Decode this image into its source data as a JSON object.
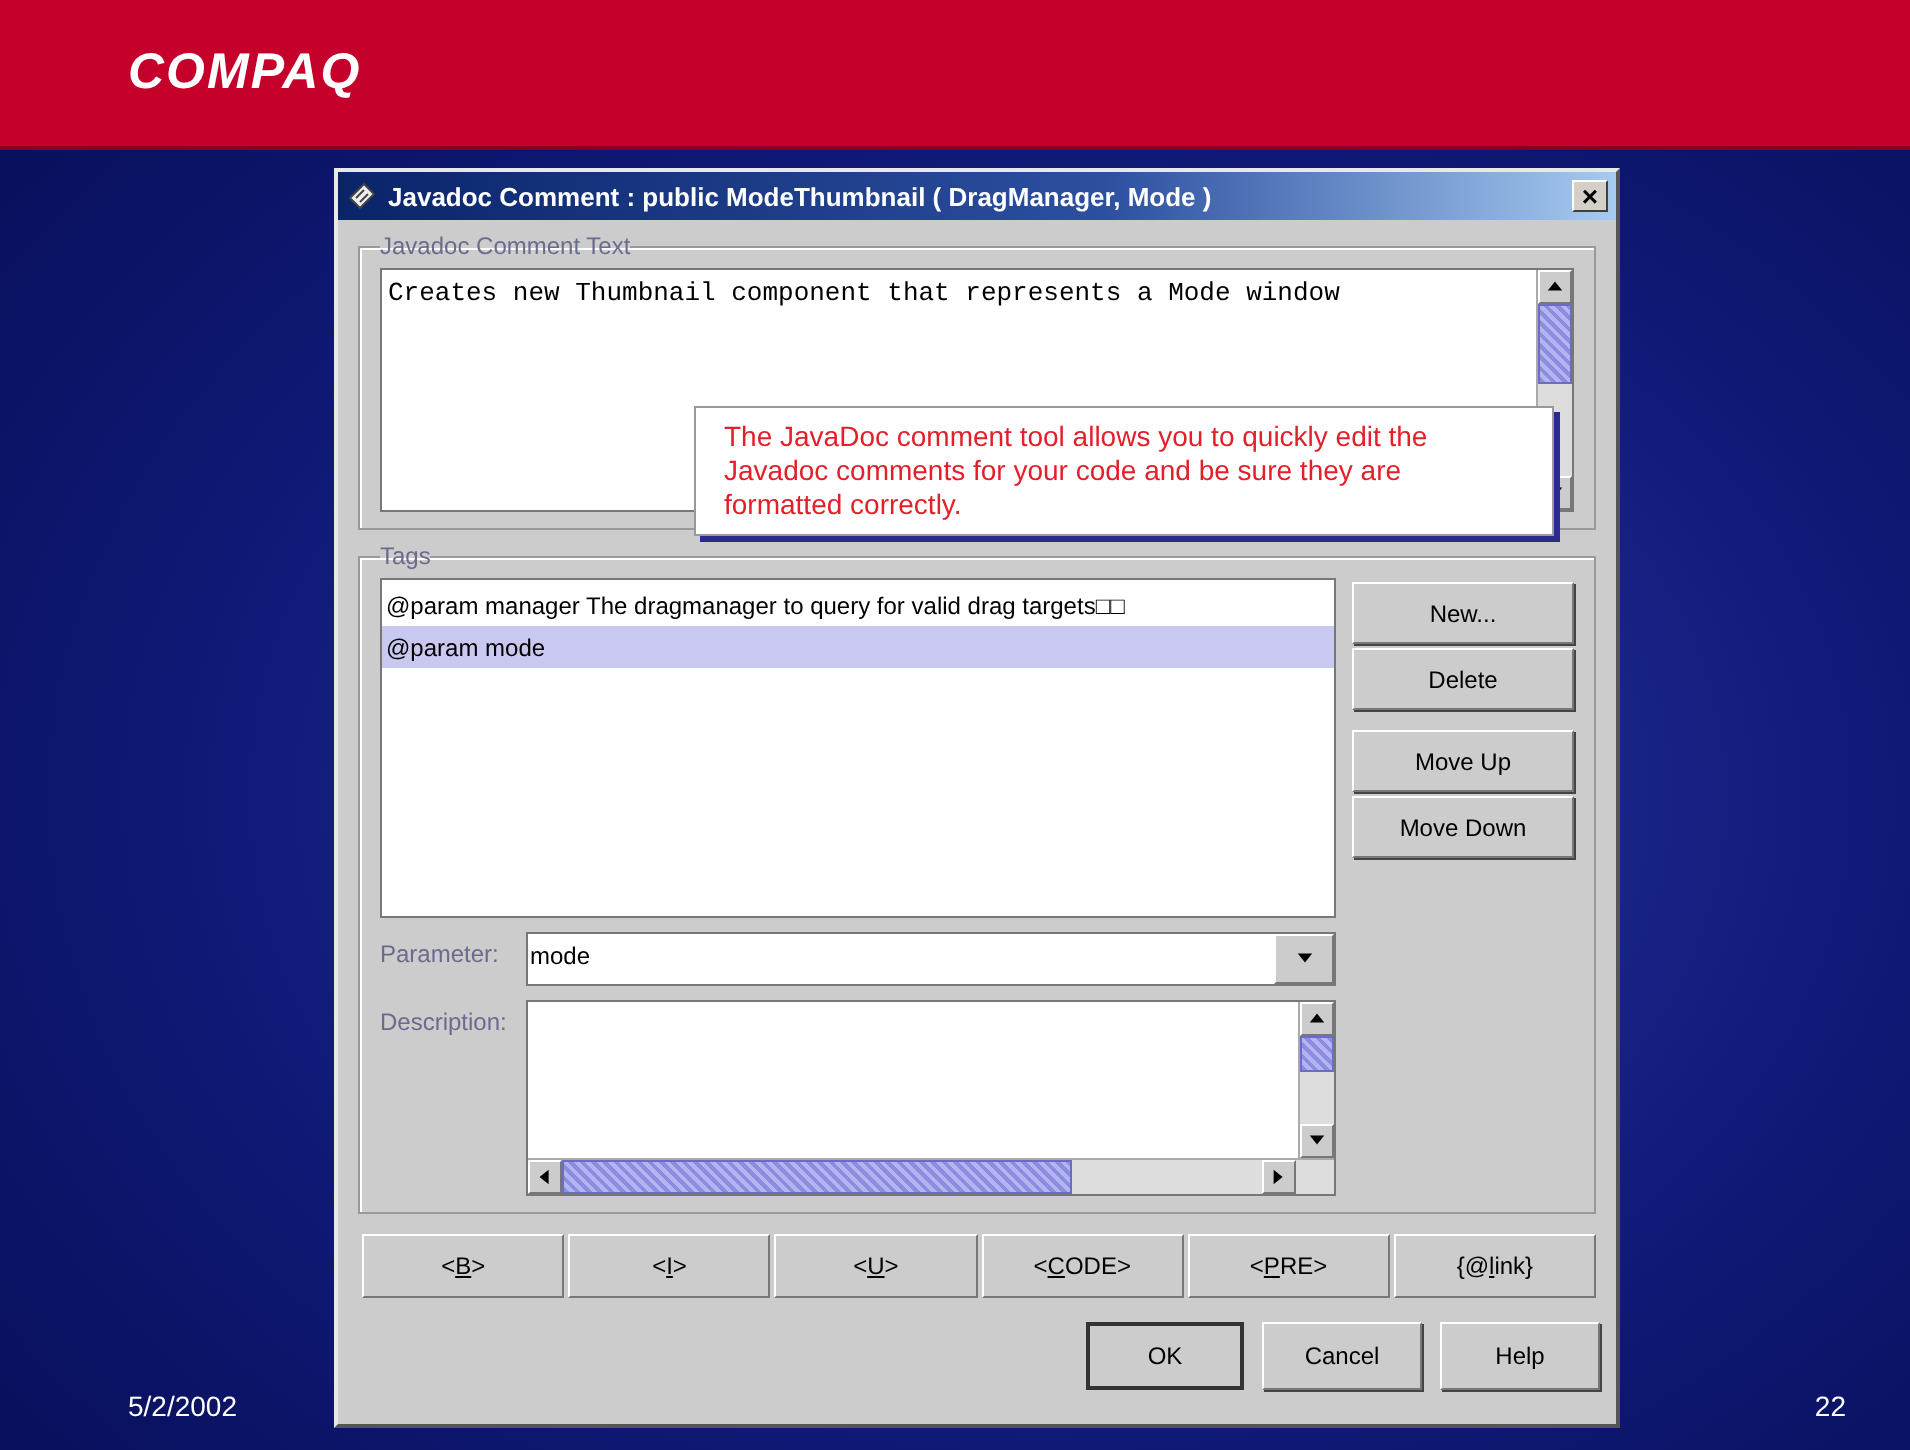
{
  "slide": {
    "logo": "COMPAQ",
    "date": "5/2/2002",
    "page_number": "22"
  },
  "dialog": {
    "title": "Javadoc Comment : public ModeThumbnail ( DragManager, Mode )",
    "close": "×",
    "comment_group": {
      "label": "Javadoc Comment Text",
      "text": "Creates new Thumbnail component that represents a Mode window"
    },
    "callout": "The JavaDoc comment tool allows you to quickly edit the Javadoc comments for your code and be sure they are formatted correctly.",
    "tags_group": {
      "label": "Tags",
      "items": [
        {
          "text": "@param manager The dragmanager to query for valid drag targets□□",
          "selected": false
        },
        {
          "text": "@param mode",
          "selected": true
        }
      ],
      "buttons": [
        "New...",
        "Delete",
        "Move Up",
        "Move Down"
      ],
      "parameter_label": "Parameter:",
      "parameter_value": "mode",
      "description_label": "Description:"
    },
    "format_buttons": [
      {
        "before": "<",
        "key": "B",
        "after": ">"
      },
      {
        "before": "<",
        "key": "I",
        "after": ">"
      },
      {
        "before": "<",
        "key": "U",
        "after": ">"
      },
      {
        "before": "<",
        "key": "C",
        "after": "ODE>"
      },
      {
        "before": "<",
        "key": "P",
        "after": "RE>"
      },
      {
        "before": "{@",
        "key": "l",
        "after": "ink}"
      }
    ],
    "buttons": [
      {
        "label": "OK",
        "default": true
      },
      {
        "label": "Cancel",
        "default": false
      },
      {
        "label": "Help",
        "default": false
      }
    ]
  }
}
